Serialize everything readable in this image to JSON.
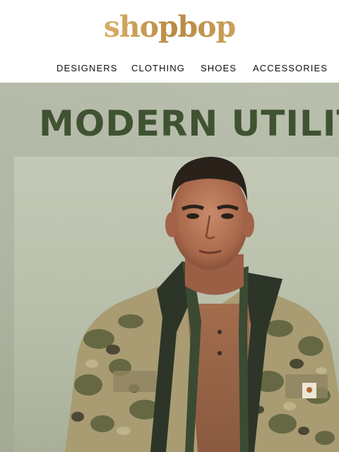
{
  "brand": {
    "logo_text": "shopbop"
  },
  "nav": {
    "items": [
      {
        "label": "DESIGNERS"
      },
      {
        "label": "CLOTHING"
      },
      {
        "label": "SHOES"
      },
      {
        "label": "ACCESSORIES"
      }
    ]
  },
  "hero": {
    "headline": "MODERN UTILIT",
    "accent_color": "#3f5232",
    "image_description_icon": "model-photo"
  },
  "colors": {
    "logo_gold": "#c79c54",
    "hero_bg": "#aab19c",
    "nav_text": "#111111"
  }
}
